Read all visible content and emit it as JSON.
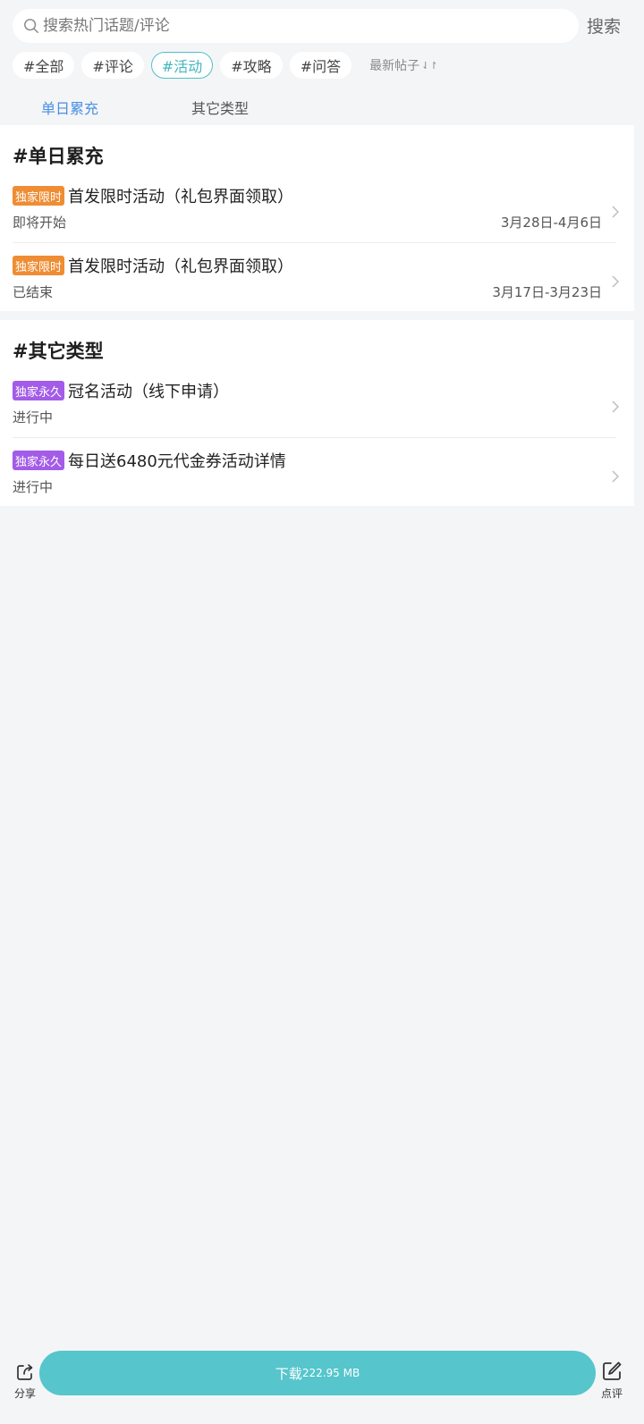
{
  "search": {
    "placeholder": "搜索热门话题/评论",
    "button_label": "搜索"
  },
  "filters": {
    "chips": [
      "#全部",
      "#评论",
      "#活动",
      "#攻略",
      "#问答"
    ],
    "active": "#活动",
    "sort_label": "最新帖子",
    "sort_icon": "sort-arrows-icon"
  },
  "tabs": [
    "单日累充",
    "其它类型"
  ],
  "sections": [
    {
      "title": "#单日累充",
      "items": [
        {
          "tag": "独家限时",
          "tag_color": "#ef8d34",
          "title": "首发限时活动（礼包界面领取）",
          "status": "即将开始",
          "date": "3月28日-4月6日"
        },
        {
          "tag": "独家限时",
          "tag_color": "#ef8d34",
          "title": "首发限时活动（礼包界面领取）",
          "status": "已结束",
          "date": "3月17日-3月23日"
        }
      ]
    },
    {
      "title": "#其它类型",
      "items": [
        {
          "tag": "独家永久",
          "tag_color": "#a35ce8",
          "title": "冠名活动（线下申请）",
          "status": "进行中"
        },
        {
          "tag": "独家永久",
          "tag_color": "#a35ce8",
          "title": "每日送6480元代金券活动详情",
          "status": "进行中"
        }
      ]
    }
  ],
  "bottom_bar": {
    "share_label": "分享",
    "download_label": "下载",
    "download_size": "222.95 MB",
    "review_label": "点评"
  },
  "colors": {
    "accent": "#56c5cc",
    "tab_active": "#4a90e2",
    "tag_limited": "#ef8d34",
    "tag_permanent": "#a35ce8"
  }
}
